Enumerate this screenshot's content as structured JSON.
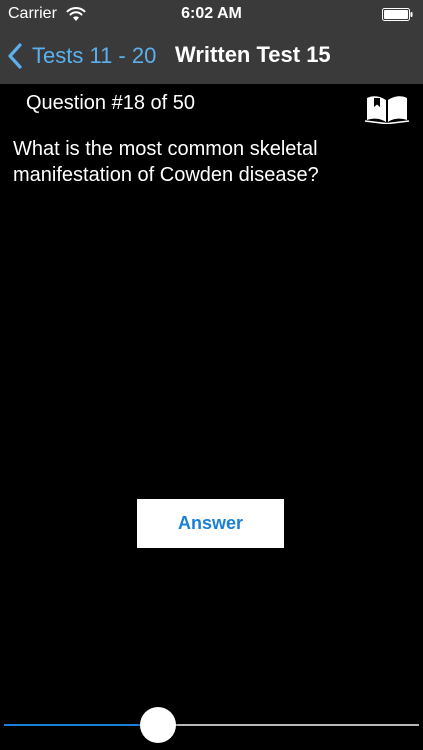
{
  "status_bar": {
    "carrier": "Carrier",
    "time": "6:02 AM"
  },
  "nav": {
    "back_label": "Tests 11 - 20",
    "title": "Written Test 15"
  },
  "question": {
    "counter": "Question #18 of 50",
    "text": "What is the most common skeletal manifestation of Cowden disease?"
  },
  "answer_button": {
    "label": "Answer"
  },
  "progress_slider": {
    "value": 0.36
  },
  "colors": {
    "accent": "#1a7fd6",
    "back_link": "#5ab1ee",
    "nav_background": "#3a3a3a",
    "background": "#000000"
  },
  "icons": {
    "wifi": "wifi-icon",
    "battery": "battery-icon",
    "back": "chevron-left-icon",
    "book": "open-book-icon"
  }
}
